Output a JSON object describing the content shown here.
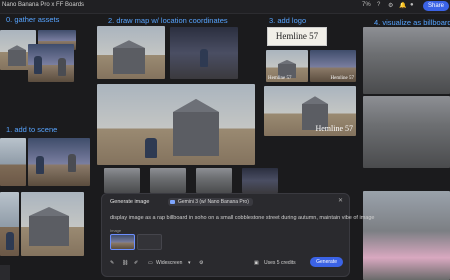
{
  "window": {
    "title": "Nano Banana Pro x FF Boards"
  },
  "toolbar": {
    "zoom": "7%",
    "share_label": "Share"
  },
  "sections": {
    "s0": "0.  gather assets",
    "s1": "1.  add to scene",
    "s2": "2.  draw map w/ location coordinates",
    "s3": "3.  add logo",
    "s4": "4.  visualize as billboard"
  },
  "logo": {
    "text": "Hemline 57"
  },
  "panel": {
    "title": "Generate image",
    "model": "Gemini 3 (w/ Nano Banana Pro)",
    "prompt": "display image as a rap billboard in soho on a small cobblestone street during autumn, maintain vibe of image",
    "image_label": "Image",
    "aspect": "Widescreen",
    "credits": "Uses 5 credits",
    "generate_label": "Generate"
  }
}
